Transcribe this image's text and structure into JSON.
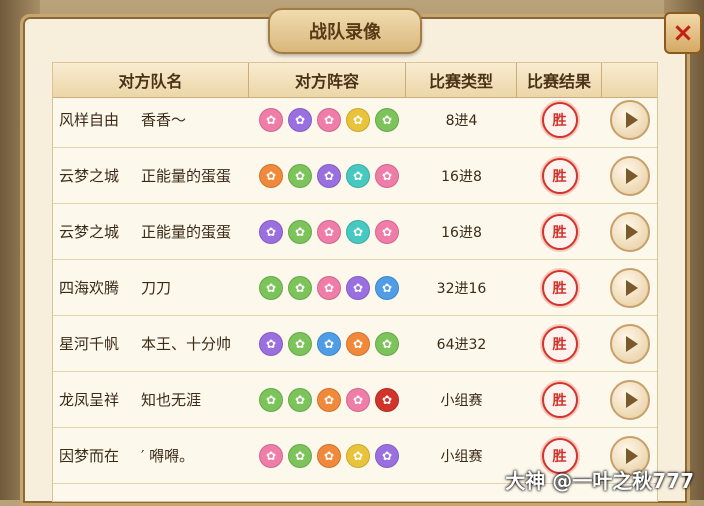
{
  "title": "战队录像",
  "close_icon": "×",
  "headers": [
    "对方队名",
    "对方阵容",
    "比赛类型",
    "比赛结果"
  ],
  "colors": {
    "purple": "#9a6fe0",
    "green": "#7cc35a",
    "pink": "#f07ca8",
    "yellow": "#e9c43b",
    "teal": "#46c9c0",
    "orange": "#f08a3a",
    "blue": "#4f9de6",
    "red": "#d0342b"
  },
  "rows": [
    {
      "team": "风样自由",
      "player": "香香～",
      "type": "8进4",
      "result": "胜",
      "lineup": [
        {
          "icon": "pink-flower-icon",
          "c": "pink"
        },
        {
          "icon": "purple-skull-icon",
          "c": "purple"
        },
        {
          "icon": "pink-swirl-icon",
          "c": "pink"
        },
        {
          "icon": "yellow-gem-icon",
          "c": "yellow"
        },
        {
          "icon": "green-leaf-icon",
          "c": "green"
        }
      ]
    },
    {
      "team": "云梦之城",
      "player": "正能量的蛋蛋",
      "type": "16进8",
      "result": "胜",
      "lineup": [
        {
          "icon": "orange-sun-icon",
          "c": "orange"
        },
        {
          "icon": "green-leaf-icon",
          "c": "green"
        },
        {
          "icon": "purple-skull-icon",
          "c": "purple"
        },
        {
          "icon": "teal-wave-icon",
          "c": "teal"
        },
        {
          "icon": "pink-flower-icon",
          "c": "pink"
        }
      ]
    },
    {
      "team": "云梦之城",
      "player": "正能量的蛋蛋",
      "type": "16进8",
      "result": "胜",
      "lineup": [
        {
          "icon": "purple-skull-icon",
          "c": "purple"
        },
        {
          "icon": "green-leaf-icon",
          "c": "green"
        },
        {
          "icon": "pink-pagoda-icon",
          "c": "pink"
        },
        {
          "icon": "teal-wave-icon",
          "c": "teal"
        },
        {
          "icon": "pink-swirl-icon",
          "c": "pink"
        }
      ]
    },
    {
      "team": "四海欢腾",
      "player": "刀刀",
      "type": "32进16",
      "result": "胜",
      "lineup": [
        {
          "icon": "green-leaf-icon",
          "c": "green"
        },
        {
          "icon": "green-leaf-icon",
          "c": "green"
        },
        {
          "icon": "pink-flower-icon",
          "c": "pink"
        },
        {
          "icon": "purple-skull-icon",
          "c": "purple"
        },
        {
          "icon": "blue-wave-icon",
          "c": "blue"
        }
      ]
    },
    {
      "team": "星河千帆",
      "player": "本王、十分帅",
      "type": "64进32",
      "result": "胜",
      "lineup": [
        {
          "icon": "purple-skull-icon",
          "c": "purple"
        },
        {
          "icon": "green-leaf-icon",
          "c": "green"
        },
        {
          "icon": "blue-wave-icon",
          "c": "blue"
        },
        {
          "icon": "orange-flame-icon",
          "c": "orange"
        },
        {
          "icon": "green-leaf-icon",
          "c": "green"
        }
      ]
    },
    {
      "team": "龙凤呈祥",
      "player": "知也无涯",
      "type": "小组赛",
      "result": "胜",
      "lineup": [
        {
          "icon": "green-leaf-icon",
          "c": "green"
        },
        {
          "icon": "green-leaf-icon",
          "c": "green"
        },
        {
          "icon": "orange-sun-icon",
          "c": "orange"
        },
        {
          "icon": "pink-flower-icon",
          "c": "pink"
        },
        {
          "icon": "red-beast-icon",
          "c": "red"
        }
      ]
    },
    {
      "team": "因梦而在",
      "player": "′ 嘚嘚。",
      "type": "小组赛",
      "result": "胜",
      "lineup": [
        {
          "icon": "pink-flower-icon",
          "c": "pink"
        },
        {
          "icon": "green-leaf-icon",
          "c": "green"
        },
        {
          "icon": "orange-sun-icon",
          "c": "orange"
        },
        {
          "icon": "yellow-gem-icon",
          "c": "yellow"
        },
        {
          "icon": "purple-skull-icon",
          "c": "purple"
        }
      ]
    }
  ],
  "watermark": "大神 @一叶之秋777"
}
